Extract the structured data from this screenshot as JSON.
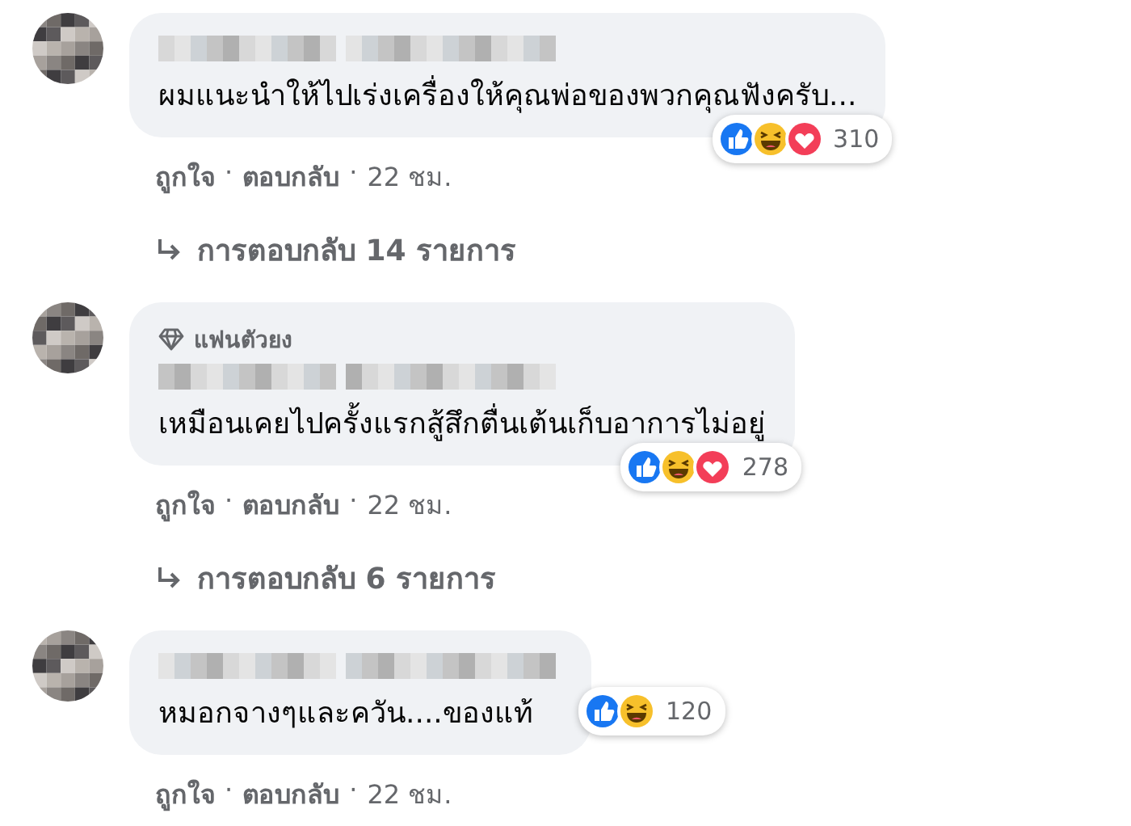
{
  "comments": [
    {
      "text": "ผมแนะนำให้ไปเร่งเครื่องให้คุณพ่อของพวกคุณฟังครับ...",
      "reactions": [
        {
          "kind": "like"
        },
        {
          "kind": "haha"
        },
        {
          "kind": "love"
        }
      ],
      "reaction_count": "310",
      "actions": [
        {
          "kind": "link",
          "text": "ถูกใจ"
        },
        {
          "kind": "dot",
          "text": "·"
        },
        {
          "kind": "link",
          "text": "ตอบกลับ"
        },
        {
          "kind": "dot",
          "text": "·"
        },
        {
          "kind": "time",
          "text": "22 ชม."
        }
      ],
      "replies": "การตอบกลับ 14 รายการ"
    },
    {
      "badge": "แฟนตัวยง",
      "text": "เหมือนเคยไปครั้งแรกสู้สึกตื่นเต้นเก็บอาการไม่อยู่",
      "reactions": [
        {
          "kind": "like"
        },
        {
          "kind": "haha"
        },
        {
          "kind": "love"
        }
      ],
      "reaction_count": "278",
      "actions": [
        {
          "kind": "link",
          "text": "ถูกใจ"
        },
        {
          "kind": "dot",
          "text": "·"
        },
        {
          "kind": "link",
          "text": "ตอบกลับ"
        },
        {
          "kind": "dot",
          "text": "·"
        },
        {
          "kind": "time",
          "text": "22 ชม."
        }
      ],
      "replies": "การตอบกลับ 6 รายการ"
    },
    {
      "text": "หมอกจางๆและควัน....ของแท้",
      "reactions": [
        {
          "kind": "like"
        },
        {
          "kind": "haha"
        }
      ],
      "reaction_count": "120",
      "actions": [
        {
          "kind": "link",
          "text": "ถูกใจ"
        },
        {
          "kind": "dot",
          "text": "·"
        },
        {
          "kind": "link",
          "text": "ตอบกลับ"
        },
        {
          "kind": "dot",
          "text": "·"
        },
        {
          "kind": "time",
          "text": "22 ชม."
        }
      ]
    }
  ]
}
